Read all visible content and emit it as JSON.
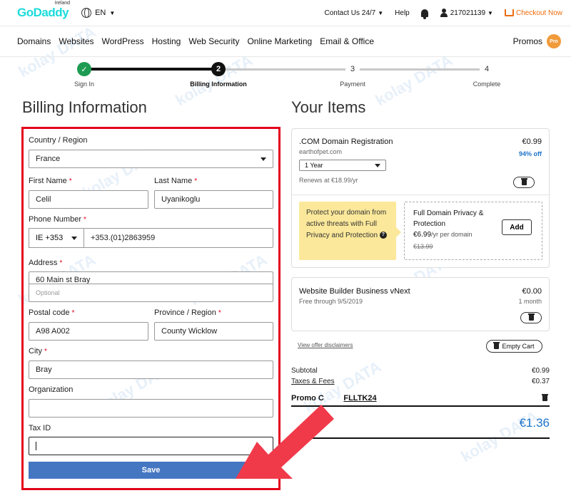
{
  "topbar": {
    "logo": "GoDaddy",
    "logo_country": "Ireland",
    "language": "EN",
    "contact": "Contact Us 24/7",
    "help": "Help",
    "account": "217021139",
    "checkout": "Checkout Now"
  },
  "nav": {
    "items": [
      "Domains",
      "Websites",
      "WordPress",
      "Hosting",
      "Web Security",
      "Online Marketing",
      "Email & Office"
    ],
    "promos": "Promos",
    "pro_badge": "Pro"
  },
  "stepper": {
    "steps": [
      {
        "num": "✓",
        "label": "Sign In",
        "state": "done"
      },
      {
        "num": "2",
        "label": "Billing Information",
        "state": "active"
      },
      {
        "num": "3",
        "label": "Payment",
        "state": "todo"
      },
      {
        "num": "4",
        "label": "Complete",
        "state": "todo"
      }
    ]
  },
  "billing": {
    "heading": "Billing Information",
    "country_label": "Country / Region",
    "country_value": "France",
    "first_name_label": "First Name",
    "first_name_value": "Celil",
    "last_name_label": "Last Name",
    "last_name_value": "Uyanikoglu",
    "phone_label": "Phone Number",
    "phone_code": "IE +353",
    "phone_value": "+353.(01)2863959",
    "address_label": "Address",
    "address_value": "60 Main st Bray",
    "address2_placeholder": "Optional",
    "postal_label": "Postal code",
    "postal_value": "A98 A002",
    "province_label": "Province / Region",
    "province_value": "County Wicklow",
    "city_label": "City",
    "city_value": "Bray",
    "org_label": "Organization",
    "org_value": "",
    "tax_label": "Tax ID",
    "tax_value": "",
    "required_mark": "*",
    "save_label": "Save"
  },
  "items": {
    "heading": "Your Items",
    "domain": {
      "title": ".COM Domain Registration",
      "name": "earthofpet.com",
      "price": "€0.99",
      "discount": "94% off",
      "term": "1 Year",
      "renews": "Renews at €18.99/yr"
    },
    "upsell": {
      "text": "Protect your domain from active threats with Full Privacy and Protection",
      "help_icon": "?"
    },
    "privacy": {
      "title": "Full Domain Privacy & Protection",
      "price": "€6.99",
      "per": "/yr per domain",
      "old_price": "€13.99",
      "add_label": "Add"
    },
    "builder": {
      "title": "Website Builder Business vNext",
      "sub": "Free through 9/5/2019",
      "price": "€0.00",
      "term": "1 month"
    },
    "disclaimers": "View offer disclaimers",
    "empty_cart": "Empty Cart",
    "subtotal_label": "Subtotal",
    "subtotal_value": "€0.99",
    "taxes_label": "Taxes & Fees",
    "taxes_value": "€0.37",
    "promo_label": "Promo C",
    "promo_code": "FLLTK24",
    "total": "€1.36"
  },
  "watermark": "kolay DATA",
  "colors": {
    "brand": "#1bdbdb",
    "highlight_box": "#e3001b",
    "save_button": "#4576c2",
    "total": "#1d73c9",
    "arrow": "#f03a4a",
    "upsell_bg": "#fbe89a"
  }
}
